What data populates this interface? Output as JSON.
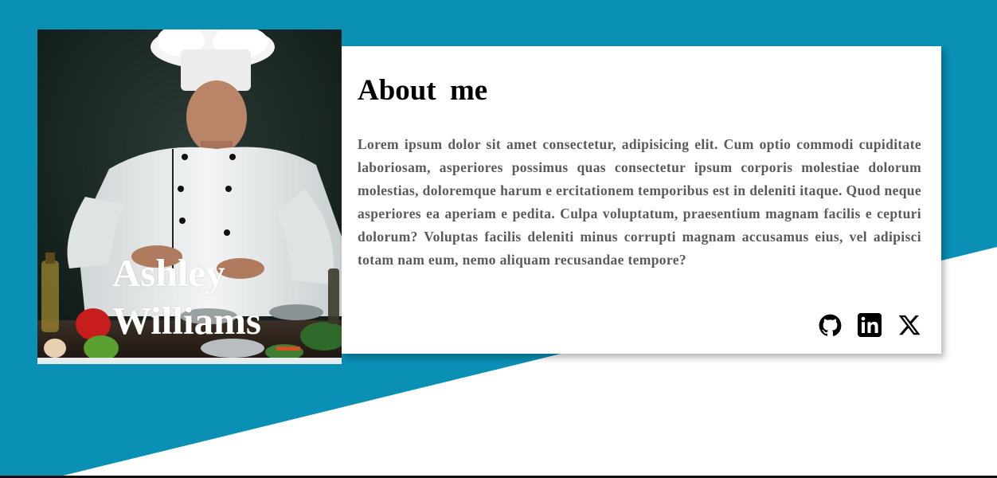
{
  "profile": {
    "name": "Ashley Williams"
  },
  "about": {
    "title": "About  me",
    "text": "Lorem ipsum dolor sit amet consectetur, adipisicing elit. Cum optio commodi cupiditate laboriosam, asperiores possimus quas consectetur ipsum corporis molestiae dolorum molestias, doloremque harum e ercitationem temporibus est in deleniti itaque. Quod neque asperiores ea aperiam e pedita. Culpa voluptatum, praesentium magnam facilis e cepturi dolorum? Voluptas facilis deleniti minus corrupti magnam accusamus eius, vel adipisci totam nam eum, nemo aliquam recusandae tempore?"
  },
  "socials": [
    {
      "name": "github-icon"
    },
    {
      "name": "linkedin-icon"
    },
    {
      "name": "x-twitter-icon"
    }
  ],
  "colors": {
    "background_accent": "#0a8fb5",
    "card_background": "#ffffff",
    "body_text": "#5a5a5a"
  }
}
